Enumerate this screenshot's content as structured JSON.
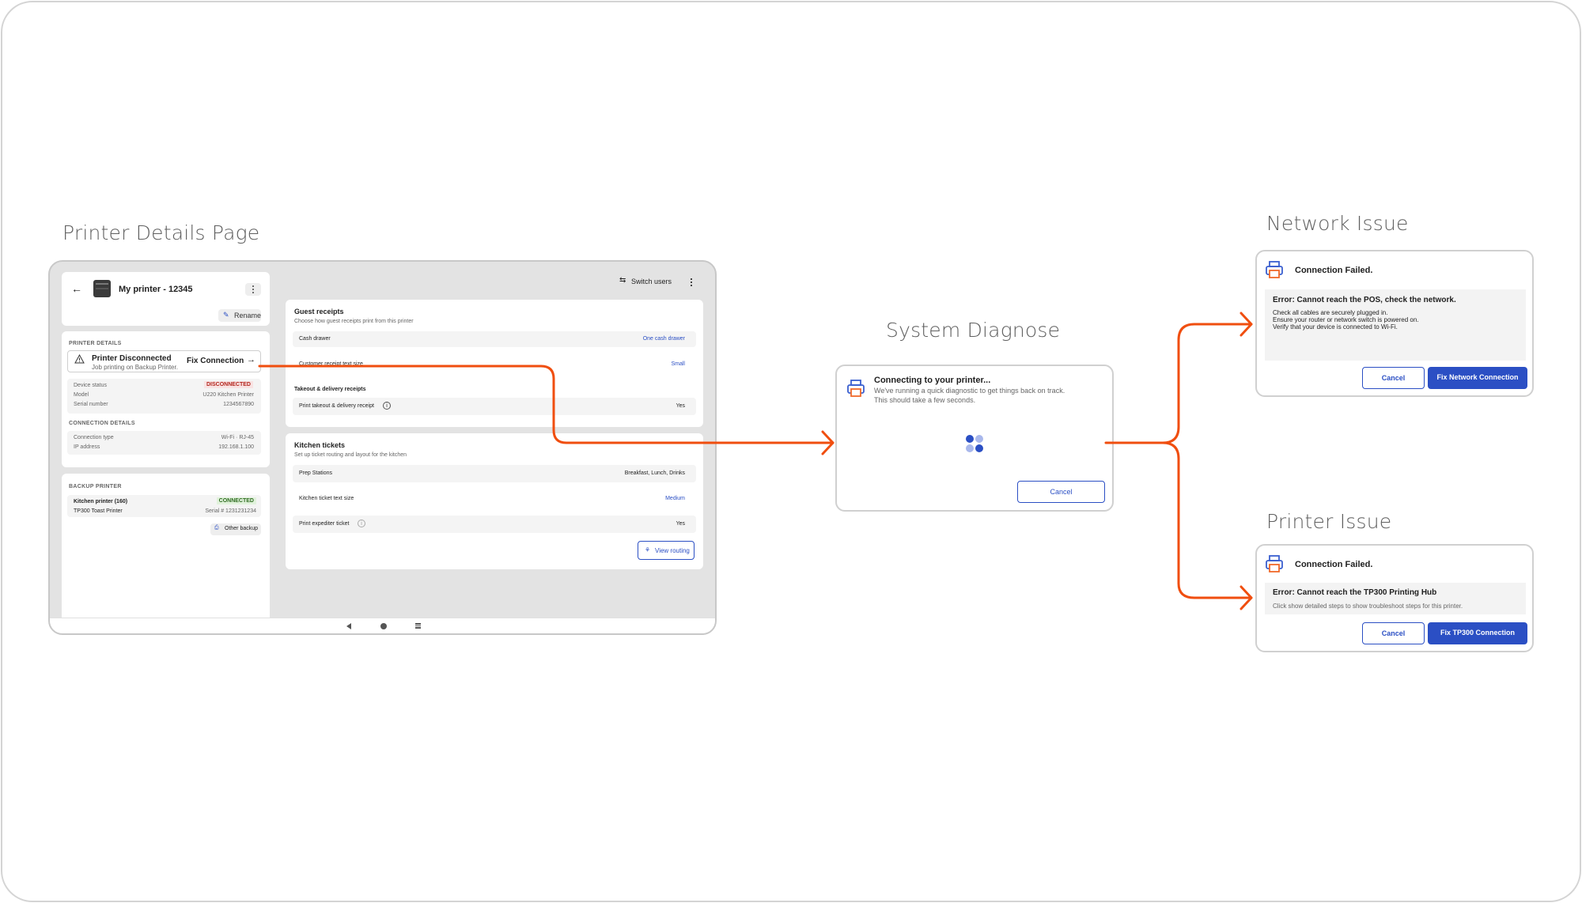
{
  "sections": {
    "printer_details": "Printer Details Page",
    "system_diagnose": "System Diagnose",
    "network_issue": "Network Issue",
    "printer_issue": "Printer Issue"
  },
  "printer_page": {
    "printer_name": "My printer - 12345",
    "rename": "Rename",
    "printer_details_heading": "PRINTER DETAILS",
    "alert_title": "Printer Disconnected",
    "alert_sub": "Job printing on Backup Printer.",
    "fix_connection": "Fix Connection",
    "device_rows": [
      {
        "label": "Device status",
        "value": "DISCONNECTED"
      },
      {
        "label": "Model",
        "value": "U220 Kitchen Printer"
      },
      {
        "label": "Serial number",
        "value": "1234567890"
      }
    ],
    "connection_heading": "CONNECTION DETAILS",
    "connection_type_label": "Connection type",
    "connection_type_value": "Wi-Fi · RJ-45",
    "ip_label": "IP address",
    "ip_value": "192.168.1.100",
    "backup_heading": "BACKUP PRINTER",
    "backup_name": "Kitchen printer (160)",
    "backup_status": "CONNECTED",
    "backup_model": "TP300 Toast Printer",
    "backup_serial": "Serial # 1231231234",
    "other_backup": "Other backup",
    "switch_users": "Switch users",
    "guest_title": "Guest receipts",
    "guest_sub": "Choose how guest receipts print from this printer",
    "cash_drawer_label": "Cash drawer",
    "cash_drawer_value": "One cash drawer",
    "receipt_size_label": "Customer receipt text size",
    "receipt_size_value": "Small",
    "takeout_heading": "Takeout & delivery receipts",
    "takeout_label": "Print takeout & delivery receipt",
    "takeout_value": "Yes",
    "kitchen_title": "Kitchen tickets",
    "kitchen_sub": "Set up ticket routing and layout for the kitchen",
    "prep_label": "Prep Stations",
    "prep_value": "Breakfast, Lunch, Drinks",
    "ticket_size_label": "Kitchen ticket text size",
    "ticket_size_value": "Medium",
    "expediter_label": "Print expediter ticket",
    "expediter_value": "Yes",
    "view_routing": "View routing"
  },
  "diagnose": {
    "title": "Connecting to your printer...",
    "line1": "We've running a quick diagnostic to get things back on track.",
    "line2": "This should take a few seconds.",
    "cancel": "Cancel"
  },
  "network": {
    "title": "Connection Failed.",
    "error": "Error: Cannot reach the POS, check the network.",
    "steps": [
      "Check all cables are securely plugged in.",
      "Ensure your router or network switch is powered on.",
      "Verify that your device is connected to Wi-Fi."
    ],
    "cancel": "Cancel",
    "fix": "Fix Network Connection"
  },
  "printer_issue": {
    "title": "Connection Failed.",
    "error": "Error: Cannot reach the TP300 Printing Hub",
    "hint": "Click show detailed steps to show troubleshoot steps for this printer.",
    "cancel": "Cancel",
    "fix": "Fix TP300 Connection"
  },
  "colors": {
    "accent_orange": "#f04e0f",
    "primary_blue": "#2b4fc4",
    "printer_icon_blue": "#3a5fcf",
    "printer_icon_orange": "#f06a2a"
  },
  "icons": [
    "back-arrow-icon",
    "printer-device-icon",
    "kebab-icon",
    "pencil-icon",
    "warning-icon",
    "arrow-right-icon",
    "switch-users-icon",
    "info-icon",
    "routing-icon",
    "printer-icon",
    "loading-spinner"
  ]
}
